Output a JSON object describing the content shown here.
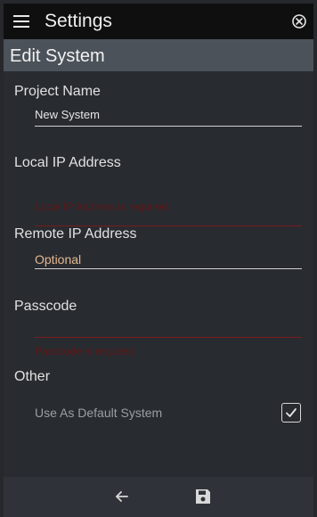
{
  "app": {
    "title": "Settings"
  },
  "header": {
    "section_title": "Edit System"
  },
  "form": {
    "project_name": {
      "label": "Project Name",
      "value": "New System"
    },
    "local_ip": {
      "label": "Local IP Address",
      "error": "Local IP Address is required"
    },
    "remote_ip": {
      "label": "Remote IP Address",
      "placeholder": "Optional"
    },
    "passcode": {
      "label": "Passcode",
      "error": "Passcode is required"
    },
    "other": {
      "label": "Other",
      "default_system_label": "Use As Default System",
      "default_system_checked": true
    }
  },
  "footer": {
    "back_icon": "arrow-left-icon",
    "save_icon": "floppy-disk-icon"
  },
  "colors": {
    "topbar": "#0f0f10",
    "section_header": "#4c525a",
    "background": "#282b30",
    "error": "#7a1b1b",
    "placeholder": "#e4b88f"
  }
}
